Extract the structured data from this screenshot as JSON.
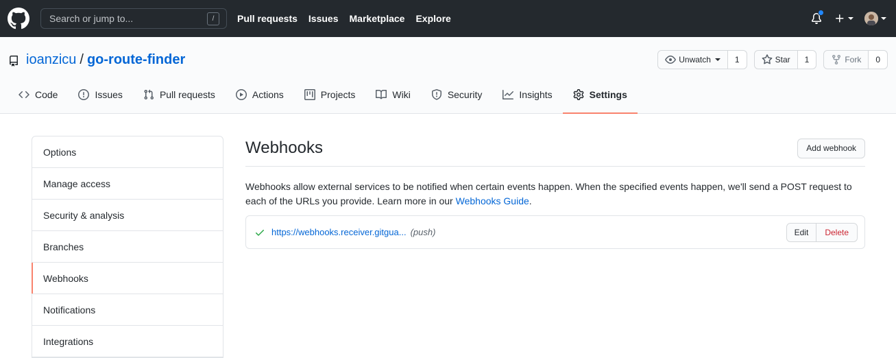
{
  "header": {
    "search_placeholder": "Search or jump to...",
    "search_shortcut": "/",
    "nav": [
      "Pull requests",
      "Issues",
      "Marketplace",
      "Explore"
    ],
    "icons": [
      "github-logo",
      "bell-icon",
      "plus-icon",
      "avatar"
    ]
  },
  "repo": {
    "owner": "ioanzicu",
    "separator": "/",
    "name": "go-route-finder",
    "watch_label": "Unwatch",
    "watch_count": "1",
    "star_label": "Star",
    "star_count": "1",
    "fork_label": "Fork",
    "fork_count": "0"
  },
  "tabs": [
    {
      "label": "Code",
      "icon": "code-icon"
    },
    {
      "label": "Issues",
      "icon": "issue-icon"
    },
    {
      "label": "Pull requests",
      "icon": "pull-request-icon"
    },
    {
      "label": "Actions",
      "icon": "play-icon"
    },
    {
      "label": "Projects",
      "icon": "project-icon"
    },
    {
      "label": "Wiki",
      "icon": "book-icon"
    },
    {
      "label": "Security",
      "icon": "shield-icon"
    },
    {
      "label": "Insights",
      "icon": "graph-icon"
    },
    {
      "label": "Settings",
      "icon": "gear-icon",
      "selected": true
    }
  ],
  "sidebar": {
    "items": [
      "Options",
      "Manage access",
      "Security & analysis",
      "Branches",
      "Webhooks",
      "Notifications",
      "Integrations"
    ],
    "selected": "Webhooks"
  },
  "main": {
    "title": "Webhooks",
    "add_button": "Add webhook",
    "description_1": "Webhooks allow external services to be notified when certain events happen. When the specified events happen, we'll send a POST request to each of the URLs you provide. Learn more in our ",
    "description_link": "Webhooks Guide",
    "description_end": ".",
    "hook": {
      "url": "https://webhooks.receiver.gitgua...",
      "event": "(push)",
      "edit_label": "Edit",
      "delete_label": "Delete"
    }
  },
  "colors": {
    "header_bg": "#24292e",
    "link": "#0366d6",
    "selected_accent": "#f9826c",
    "success": "#28a745",
    "danger": "#cb2431"
  }
}
